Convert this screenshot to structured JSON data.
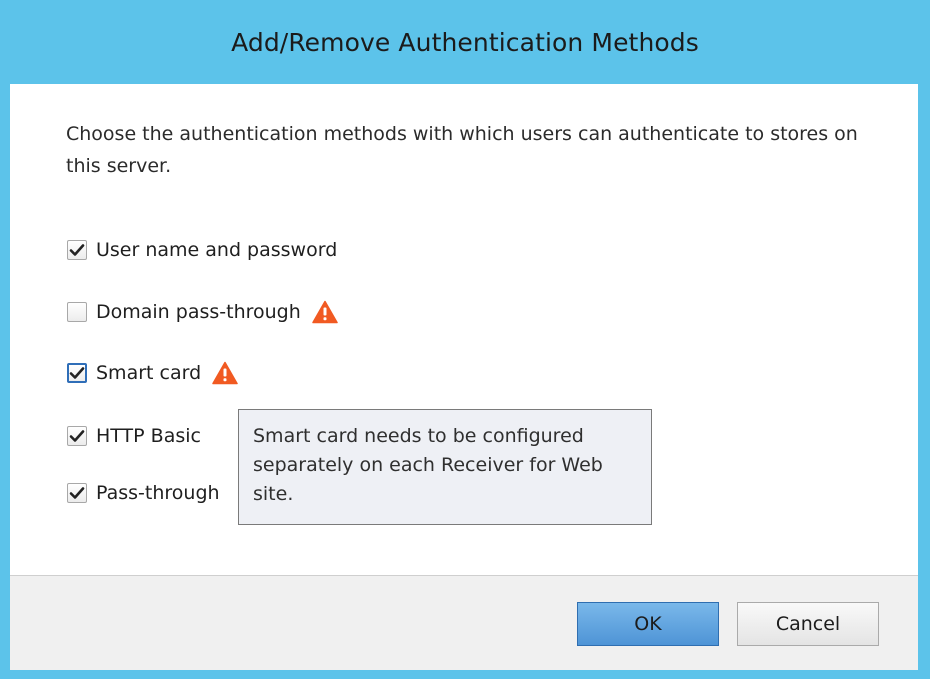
{
  "dialog": {
    "title": "Add/Remove Authentication Methods",
    "description": "Choose the authentication methods with which users can authenticate to stores on this server.",
    "accent_color": "#5cc3ea",
    "warning_color": "#f15a22"
  },
  "options": [
    {
      "label": "User name and password",
      "checked": true,
      "warning": false
    },
    {
      "label": "Domain pass-through",
      "checked": false,
      "warning": true
    },
    {
      "label": "Smart card",
      "checked": true,
      "warning": true,
      "focused": true
    },
    {
      "label": "HTTP Basic",
      "checked": true,
      "warning": false
    },
    {
      "label": "Pass-through",
      "checked": true,
      "warning": false
    }
  ],
  "tooltip": {
    "text": "Smart card needs to be configured separately on each Receiver for Web site."
  },
  "buttons": {
    "ok_label": "OK",
    "cancel_label": "Cancel"
  }
}
